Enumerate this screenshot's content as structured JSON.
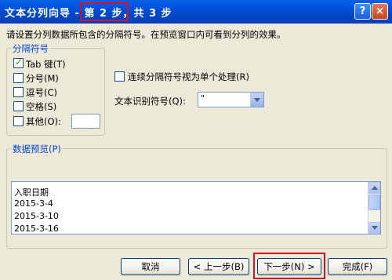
{
  "window": {
    "title": "文本分列向导 - 第 2 步，共 3 步",
    "help_label": "?",
    "close_label": "×"
  },
  "instructions": "请设置分列数据所包含的分隔符号。在预览窗口内可看到分列的效果。",
  "delimiters": {
    "group_label": "分隔符号",
    "items": [
      {
        "label": "Tab 键(T)",
        "checked": true
      },
      {
        "label": "分号(M)",
        "checked": false
      },
      {
        "label": "逗号(C)",
        "checked": false
      },
      {
        "label": "空格(S)",
        "checked": false
      },
      {
        "label": "其他(O):",
        "checked": false
      }
    ],
    "other_value": ""
  },
  "consecutive": {
    "label": "连续分隔符号视为单个处理(R)",
    "checked": false
  },
  "text_qualifier": {
    "label": "文本识别符号(Q):",
    "value": "\""
  },
  "preview": {
    "group_label": "数据预览(P)",
    "rows": [
      "入职日期",
      "2015-3-4",
      "2015-3-10",
      "2015-3-16"
    ]
  },
  "buttons": {
    "cancel": "取消",
    "back": "< 上一步(B)",
    "next": "下一步(N) >",
    "finish": "完成(F)"
  }
}
